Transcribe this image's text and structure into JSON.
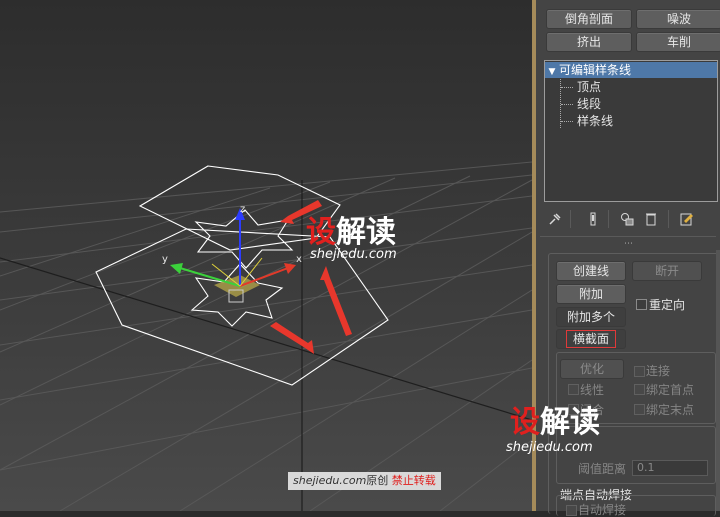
{
  "toolbar": {
    "chamfer": "倒角剖面",
    "noise": "噪波",
    "extrude": "挤出",
    "lathe": "车削"
  },
  "modifier_stack": {
    "root": "可编辑样条线",
    "children": [
      "顶点",
      "线段",
      "样条线"
    ]
  },
  "icons": {
    "pin": "pin-icon",
    "show_end": "show-end-result-icon",
    "make_unique": "make-unique-icon",
    "remove": "remove-modifier-icon",
    "configure": "configure-modifier-sets-icon"
  },
  "geometry": {
    "create_line": "创建线",
    "break": "断开",
    "attach": "附加",
    "reorient": "重定向",
    "attach_multiple": "附加多个",
    "cross_section": "横截面",
    "refine": "优化",
    "connect": "连接",
    "linear": "线性",
    "bind_first": "绑定首点",
    "closed_partial": "闭合",
    "bind_last": "绑定末点",
    "threshold_label": "阈值距离",
    "threshold_value": "0.1",
    "auto_weld": "端点自动焊接",
    "auto_weld_check": "自动焊接"
  },
  "axes": {
    "x": "x",
    "y": "y",
    "z": "z"
  },
  "watermark": {
    "logo_prefix": "设",
    "logo_rest": "解读",
    "url": "shejiedu.com",
    "footer_site": "shejiedu.com",
    "footer_original": "原创",
    "footer_forbid": "禁止转载"
  },
  "colors": {
    "viewport_grid": "#5a5a5a",
    "shape_line": "#ffffff",
    "selected_row": "#4e78a8",
    "arrow": "#e8372c",
    "watermark_red": "#e0201e",
    "highlight_box": "#e03a3a",
    "panel_border": "#a58b5a"
  }
}
